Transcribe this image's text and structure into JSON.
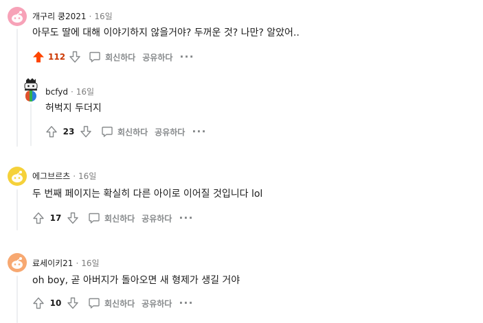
{
  "actions": {
    "reply": "회신하다",
    "share": "공유하다",
    "more": "···"
  },
  "comments": [
    {
      "author": "개구리 쿵2021",
      "separator": "·",
      "time": "16일",
      "text": "아무도 딸에 대해 이야기하지 않을거야? 두꺼운 것? 나만? 알았어..",
      "votes": "112",
      "upvoted": true,
      "avatar_color": "#f7a2b8"
    },
    {
      "author": "bcfyd",
      "separator": "·",
      "time": "16일",
      "text": "허벅지 두더지",
      "votes": "23",
      "upvoted": false
    },
    {
      "author": "에그브르츠",
      "separator": "·",
      "time": "16일",
      "text": "두 번째 페이지는 확실히 다른 아이로 이어질 것입니다 lol",
      "votes": "17",
      "upvoted": false,
      "avatar_color": "#f5d13a"
    },
    {
      "author": "료세이키21",
      "separator": "·",
      "time": "16일",
      "text": "oh boy, 곧 아버지가 돌아오면 새 형제가 생길 거야",
      "votes": "10",
      "upvoted": false,
      "avatar_color": "#f7a871"
    }
  ],
  "colors": {
    "upvote_active": "#ff4500",
    "icon_gray": "#878a8c",
    "thread_line": "#edeff1"
  }
}
